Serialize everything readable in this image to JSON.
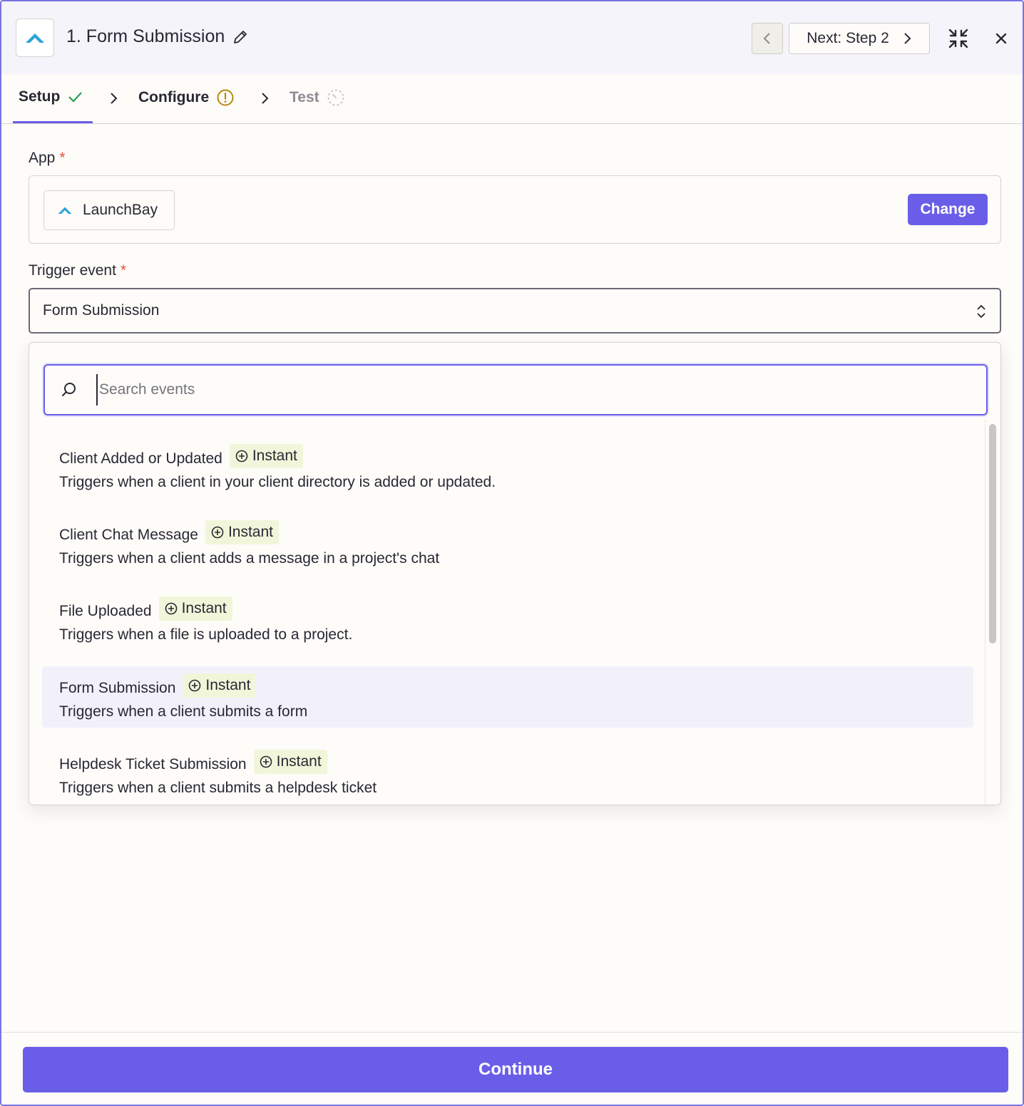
{
  "header": {
    "title": "1. Form Submission",
    "next_label": "Next: Step 2"
  },
  "tabs": [
    {
      "label": "Setup",
      "status": "complete"
    },
    {
      "label": "Configure",
      "status": "warning"
    },
    {
      "label": "Test",
      "status": "pending"
    }
  ],
  "app": {
    "label": "App",
    "required_mark": "*",
    "selected_app": "LaunchBay",
    "change_label": "Change"
  },
  "trigger": {
    "label": "Trigger event",
    "required_mark": "*",
    "selected_value": "Form Submission"
  },
  "dropdown": {
    "search_placeholder": "Search events",
    "events": [
      {
        "title": "Client Added or Updated",
        "badge": "Instant",
        "description": "Triggers when a client in your client directory is added or updated.",
        "selected": false
      },
      {
        "title": "Client Chat Message",
        "badge": "Instant",
        "description": "Triggers when a client adds a message in a project's chat",
        "selected": false
      },
      {
        "title": "File Uploaded",
        "badge": "Instant",
        "description": "Triggers when a file is uploaded to a project.",
        "selected": false
      },
      {
        "title": "Form Submission",
        "badge": "Instant",
        "description": "Triggers when a client submits a form",
        "selected": true
      },
      {
        "title": "Helpdesk Ticket Submission",
        "badge": "Instant",
        "description": "Triggers when a client submits a helpdesk ticket",
        "selected": false
      }
    ]
  },
  "footer": {
    "continue_label": "Continue"
  },
  "colors": {
    "accent": "#6a5ee8",
    "logo": "#2aa4d8",
    "required": "#e0523d",
    "success": "#2e9e55",
    "warning": "#b88a10",
    "badge_bg": "#f1f6da"
  }
}
